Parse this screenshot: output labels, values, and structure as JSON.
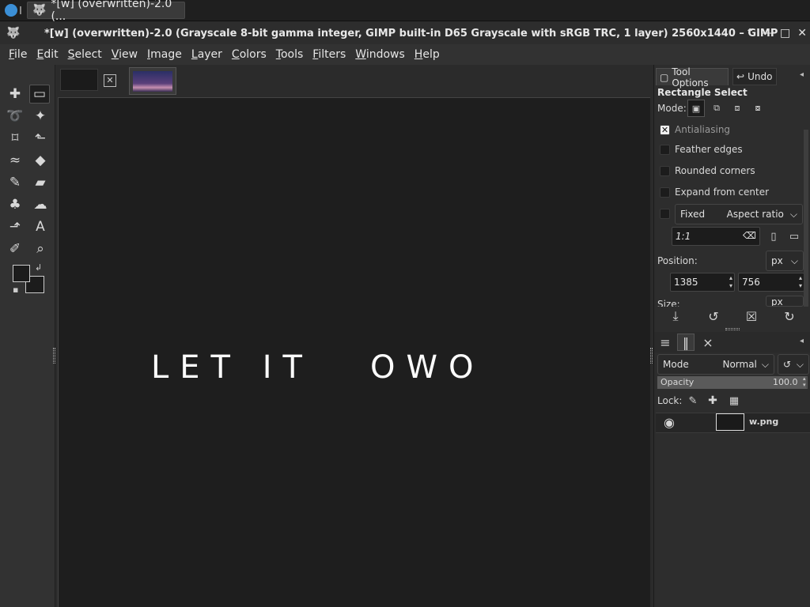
{
  "taskbar": {
    "task_title": "*[w] (overwritten)-2.0 (..."
  },
  "titlebar": {
    "title": "*[w] (overwritten)-2.0 (Grayscale 8-bit gamma integer, GIMP built-in D65 Grayscale with sRGB TRC, 1 layer) 2560x1440 – GIMP",
    "minimize": "—",
    "restore": "□",
    "close": "✕",
    "pin": "⌃"
  },
  "menubar": [
    "File",
    "Edit",
    "Select",
    "View",
    "Image",
    "Layer",
    "Colors",
    "Tools",
    "Filters",
    "Windows",
    "Help"
  ],
  "toolbox": {
    "tools": [
      {
        "name": "move-tool-icon",
        "glyph": "✚"
      },
      {
        "name": "rect-select-tool-icon",
        "glyph": "▭"
      },
      {
        "name": "lasso-tool-icon",
        "glyph": "➰"
      },
      {
        "name": "fuzzy-select-tool-icon",
        "glyph": "✦"
      },
      {
        "name": "crop-tool-icon",
        "glyph": "⌑"
      },
      {
        "name": "transform-tool-icon",
        "glyph": "⬑"
      },
      {
        "name": "warp-tool-icon",
        "glyph": "≈"
      },
      {
        "name": "bucket-fill-tool-icon",
        "glyph": "◆"
      },
      {
        "name": "paintbrush-tool-icon",
        "glyph": "✎"
      },
      {
        "name": "eraser-tool-icon",
        "glyph": "▰"
      },
      {
        "name": "clone-tool-icon",
        "glyph": "♣"
      },
      {
        "name": "smudge-tool-icon",
        "glyph": "☁"
      },
      {
        "name": "paths-tool-icon",
        "glyph": "⬏"
      },
      {
        "name": "text-tool-icon",
        "glyph": "A"
      },
      {
        "name": "color-picker-tool-icon",
        "glyph": "✐"
      },
      {
        "name": "zoom-tool-icon",
        "glyph": "⌕"
      }
    ],
    "swap_glyph": "↲",
    "reset_glyph": "▪"
  },
  "canvas": {
    "text_left": "LET IT",
    "text_right": "OWO"
  },
  "dock": {
    "tab_tool_options": "Tool Options",
    "tab_undo": "Undo",
    "section_title": "Rectangle Select",
    "mode_label": "Mode:",
    "antialiasing": "Antialiasing",
    "feather_edges": "Feather edges",
    "rounded_corners": "Rounded corners",
    "expand_from_center": "Expand from center",
    "fixed_label": "Fixed",
    "fixed_value": "Aspect ratio",
    "ratio_value": "1:1",
    "position_label": "Position:",
    "position_unit": "px",
    "pos_x": "1385",
    "pos_y": "756",
    "size_label": "Size:",
    "size_unit": "px",
    "layers_mode_label": "Mode",
    "layers_mode_value": "Normal",
    "opacity_label": "Opacity",
    "opacity_value": "100.0",
    "lock_label": "Lock:",
    "layer_name": "w.png"
  }
}
